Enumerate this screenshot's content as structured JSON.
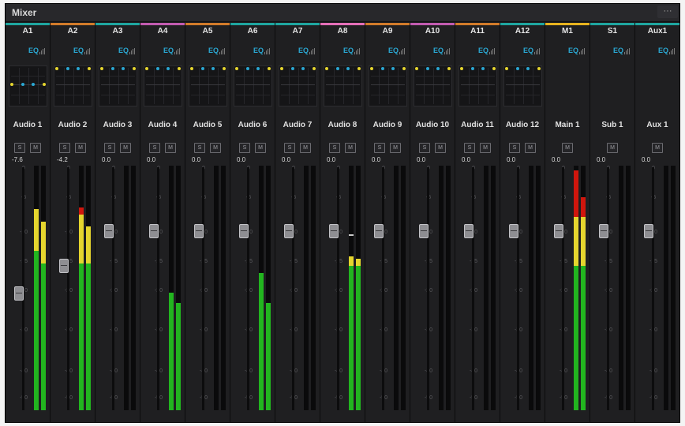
{
  "window": {
    "title": "Mixer",
    "more_icon": "ellipsis-icon"
  },
  "colors": {
    "accent_eq": "#2aa7d2",
    "meter_green": "#22b51f",
    "meter_yellow": "#e5d52e",
    "meter_red": "#d0160d"
  },
  "scale_labels": [
    "0",
    "-5",
    "-10",
    "-15",
    "-20",
    "-30",
    "-40",
    "-50"
  ],
  "buttons": {
    "solo": "S",
    "mute": "M"
  },
  "channels": [
    {
      "track": "A1",
      "eq": "EQ",
      "name": "Audio 1",
      "vol": "-7.6",
      "color": "#1fa6a0",
      "fader_db": -21,
      "meters": [
        {
          "g": 0.65,
          "y": 0.17,
          "r": 0
        },
        {
          "g": 0.6,
          "y": 0.17,
          "r": 0
        }
      ],
      "solo": true,
      "peak": false
    },
    {
      "track": "A2",
      "eq": "EQ",
      "name": "Audio 2",
      "vol": "-4.2",
      "color": "#d27b2a",
      "fader_db": -16,
      "meters": [
        {
          "g": 0.6,
          "y": 0.2,
          "r": 0.03
        },
        {
          "g": 0.6,
          "y": 0.15,
          "r": 0
        }
      ],
      "solo": true,
      "peak": false
    },
    {
      "track": "A3",
      "eq": "EQ",
      "name": "Audio 3",
      "vol": "0.0",
      "color": "#1fa6a0",
      "fader_db": -10,
      "meters": [
        {
          "g": 0,
          "y": 0,
          "r": 0
        },
        {
          "g": 0,
          "y": 0,
          "r": 0
        }
      ],
      "solo": true,
      "peak": false
    },
    {
      "track": "A4",
      "eq": "EQ",
      "name": "Audio 4",
      "vol": "0.0",
      "color": "#c25bb0",
      "fader_db": -10,
      "meters": [
        {
          "g": 0.48,
          "y": 0,
          "r": 0
        },
        {
          "g": 0.44,
          "y": 0,
          "r": 0
        }
      ],
      "solo": true,
      "peak": false
    },
    {
      "track": "A5",
      "eq": "EQ",
      "name": "Audio 5",
      "vol": "0.0",
      "color": "#d27b2a",
      "fader_db": -10,
      "meters": [
        {
          "g": 0,
          "y": 0,
          "r": 0
        },
        {
          "g": 0,
          "y": 0,
          "r": 0
        }
      ],
      "solo": true,
      "peak": false
    },
    {
      "track": "A6",
      "eq": "EQ",
      "name": "Audio 6",
      "vol": "0.0",
      "color": "#1fa6a0",
      "fader_db": -10,
      "meters": [
        {
          "g": 0.56,
          "y": 0,
          "r": 0
        },
        {
          "g": 0.44,
          "y": 0,
          "r": 0
        }
      ],
      "solo": true,
      "peak": false
    },
    {
      "track": "A7",
      "eq": "EQ",
      "name": "Audio 7",
      "vol": "0.0",
      "color": "#1fa6a0",
      "fader_db": -10,
      "meters": [
        {
          "g": 0,
          "y": 0,
          "r": 0
        },
        {
          "g": 0,
          "y": 0,
          "r": 0
        }
      ],
      "solo": true,
      "peak": false
    },
    {
      "track": "A8",
      "eq": "EQ",
      "name": "Audio 8",
      "vol": "0.0",
      "color": "#e46fb8",
      "fader_db": -10,
      "meters": [
        {
          "g": 0.59,
          "y": 0.04,
          "r": 0
        },
        {
          "g": 0.59,
          "y": 0.03,
          "r": 0
        }
      ],
      "solo": true,
      "peak": true
    },
    {
      "track": "A9",
      "eq": "EQ",
      "name": "Audio 9",
      "vol": "0.0",
      "color": "#d27b2a",
      "fader_db": -10,
      "meters": [
        {
          "g": 0,
          "y": 0,
          "r": 0
        },
        {
          "g": 0,
          "y": 0,
          "r": 0
        }
      ],
      "solo": true,
      "peak": false
    },
    {
      "track": "A10",
      "eq": "EQ",
      "name": "Audio 10",
      "vol": "0.0",
      "color": "#c25bb0",
      "fader_db": -10,
      "meters": [
        {
          "g": 0,
          "y": 0,
          "r": 0
        },
        {
          "g": 0,
          "y": 0,
          "r": 0
        }
      ],
      "solo": true,
      "peak": false
    },
    {
      "track": "A11",
      "eq": "EQ",
      "name": "Audio 11",
      "vol": "0.0",
      "color": "#d27b2a",
      "fader_db": -10,
      "meters": [
        {
          "g": 0,
          "y": 0,
          "r": 0
        },
        {
          "g": 0,
          "y": 0,
          "r": 0
        }
      ],
      "solo": true,
      "peak": false
    },
    {
      "track": "A12",
      "eq": "EQ",
      "name": "Audio 12",
      "vol": "0.0",
      "color": "#1fa6a0",
      "fader_db": -10,
      "meters": [
        {
          "g": 0,
          "y": 0,
          "r": 0
        },
        {
          "g": 0,
          "y": 0,
          "r": 0
        }
      ],
      "solo": true,
      "peak": false
    },
    {
      "track": "M1",
      "eq": "EQ",
      "name": "Main 1",
      "vol": "0.0",
      "color": "#e7b31f",
      "fader_db": -10,
      "meters": [
        {
          "g": 0.59,
          "y": 0.2,
          "r": 0.19
        },
        {
          "g": 0.59,
          "y": 0.2,
          "r": 0.08
        }
      ],
      "solo": false,
      "peak": false
    },
    {
      "track": "S1",
      "eq": "EQ",
      "name": "Sub 1",
      "vol": "0.0",
      "color": "#1fa6a0",
      "fader_db": -10,
      "meters": [
        {
          "g": 0,
          "y": 0,
          "r": 0
        },
        {
          "g": 0,
          "y": 0,
          "r": 0
        }
      ],
      "solo": false,
      "peak": false
    },
    {
      "track": "Aux1",
      "eq": "EQ",
      "name": "Aux 1",
      "vol": "0.0",
      "color": "#1fa6a0",
      "fader_db": -10,
      "meters": [
        {
          "g": 0,
          "y": 0,
          "r": 0
        },
        {
          "g": 0,
          "y": 0,
          "r": 0
        }
      ],
      "solo": false,
      "peak": false
    }
  ]
}
